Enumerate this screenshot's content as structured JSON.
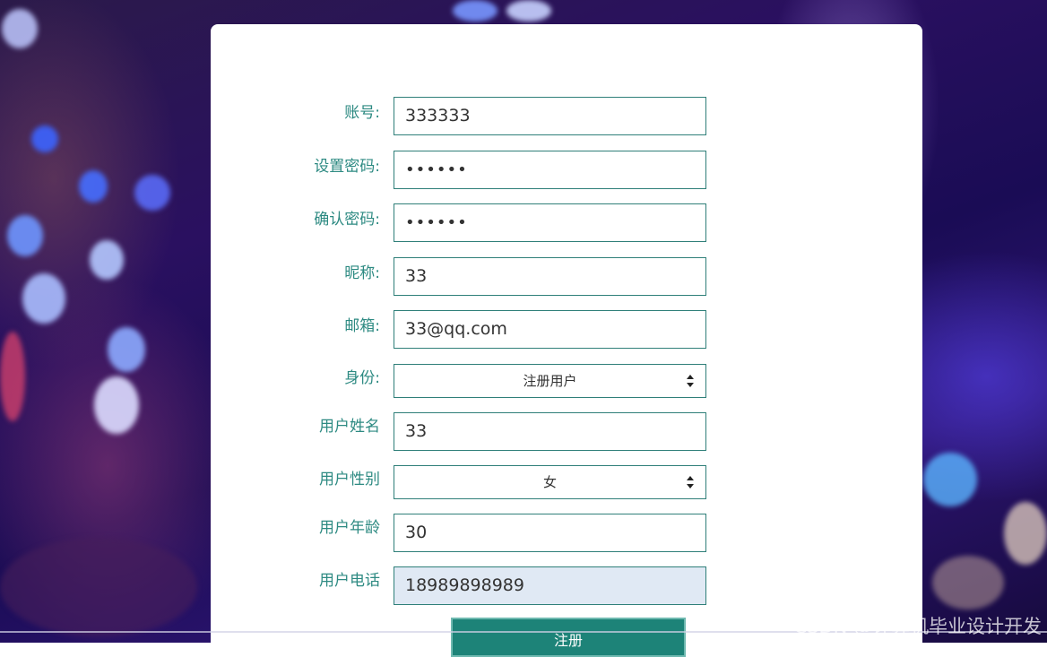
{
  "form": {
    "fields": [
      {
        "label": "账号:",
        "value": "333333",
        "type": "text"
      },
      {
        "label": "设置密码:",
        "value": "••••••",
        "type": "password"
      },
      {
        "label": "确认密码:",
        "value": "••••••",
        "type": "password"
      },
      {
        "label": "昵称:",
        "value": "33",
        "type": "text"
      },
      {
        "label": "邮箱:",
        "value": "33@qq.com",
        "type": "text"
      },
      {
        "label": "身份:",
        "value": "注册用户",
        "type": "select"
      },
      {
        "label": "用户姓名",
        "value": "33",
        "type": "text"
      },
      {
        "label": "用户性别",
        "value": "女",
        "type": "select"
      },
      {
        "label": "用户年龄",
        "value": "30",
        "type": "text"
      },
      {
        "label": "用户电话",
        "value": "18989898989",
        "type": "text"
      }
    ],
    "submit_label": "注册"
  },
  "watermark": "CSDN @计算机毕业设计开发",
  "colors": {
    "accent": "#2d8a82",
    "border": "#2f7f79",
    "button": "#1d8378",
    "autofill": "#e0e9f4"
  }
}
